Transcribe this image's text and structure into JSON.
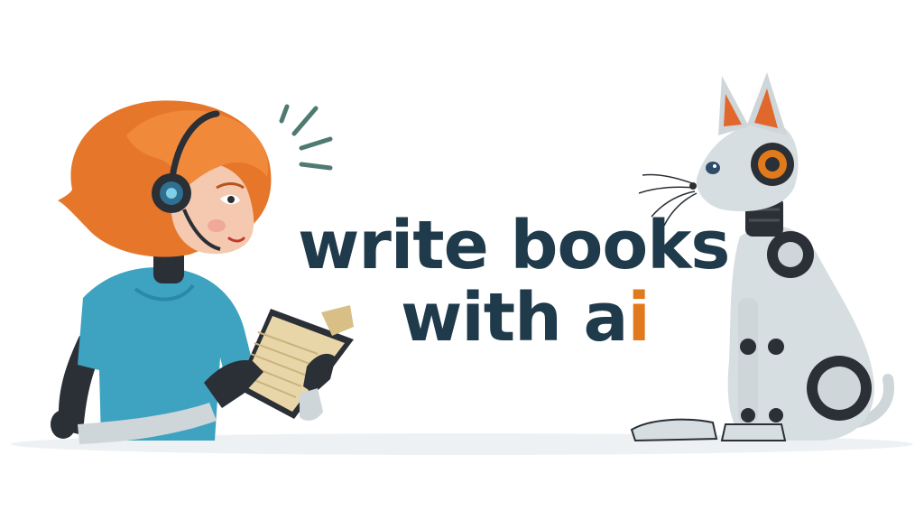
{
  "headline": {
    "line_1": "write books",
    "line_2_main": "with a",
    "line_2_accent": "i"
  },
  "colors": {
    "text": "#1f3a4a",
    "accent": "#e07a1c",
    "hair": "#e6762a",
    "shirt": "#3da3c0",
    "robot_dark": "#2b2f36",
    "robot_light": "#cfd6d9",
    "book_pages": "#e8d6a8",
    "motion_lines": "#4f7a72"
  },
  "icons": [
    "headphones-icon",
    "book-icon",
    "robot-cat-icon"
  ]
}
